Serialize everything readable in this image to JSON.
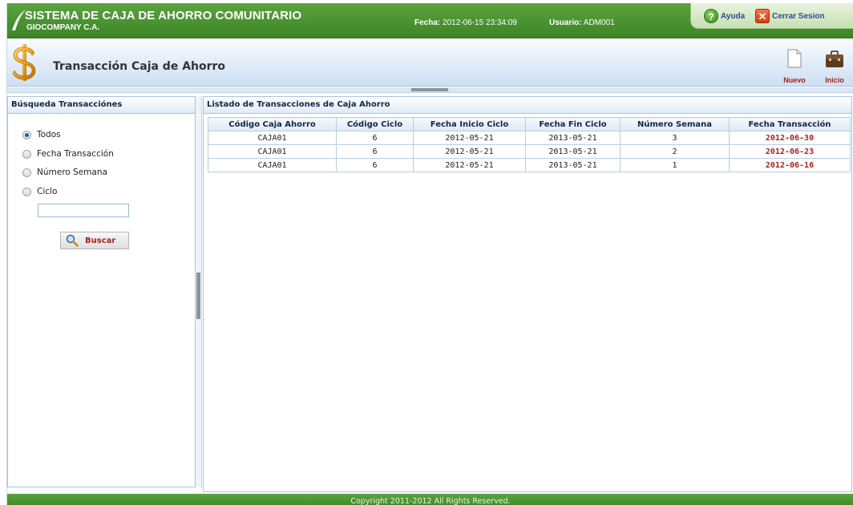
{
  "header": {
    "app_title": "SISTEMA DE CAJA DE AHORRO COMUNITARIO",
    "company": "GIOCOMPANY C.A.",
    "fecha_label": "Fecha:",
    "fecha_value": "2012-06-15 23:34:09",
    "usuario_label": "Usuario:",
    "usuario_value": "ADM001",
    "ayuda_label": "Ayuda",
    "cerrar_label": "Cerrar Sesion"
  },
  "titlebar": {
    "page_title": "Transacción Caja de Ahorro",
    "nuevo_label": "Nuevo",
    "inicio_label": "Inicio"
  },
  "search_panel": {
    "title": "Búsqueda Transacciónes",
    "options": [
      {
        "label": "Todos",
        "checked": true
      },
      {
        "label": "Fecha Transacción",
        "checked": false
      },
      {
        "label": "Número Semana",
        "checked": false
      },
      {
        "label": "Ciclo",
        "checked": false
      }
    ],
    "ciclo_value": "",
    "buscar_label": "Buscar"
  },
  "list_panel": {
    "title": "Listado de Transacciones de Caja Ahorro",
    "columns": [
      "Código Caja Ahorro",
      "Código Ciclo",
      "Fecha Inicio Ciclo",
      "Fecha Fin Ciclo",
      "Número Semana",
      "Fecha Transacción"
    ],
    "rows": [
      [
        "CAJA01",
        "6",
        "2012-05-21",
        "2013-05-21",
        "3",
        "2012-06-30"
      ],
      [
        "CAJA01",
        "6",
        "2012-05-21",
        "2013-05-21",
        "2",
        "2012-06-23"
      ],
      [
        "CAJA01",
        "6",
        "2012-05-21",
        "2013-05-21",
        "1",
        "2012-06-16"
      ]
    ]
  },
  "footer": {
    "copyright": "Copyright 2011-2012 All Rights Reserved."
  },
  "colors": {
    "header_green": "#3d8426",
    "accent_red": "#b01d1d",
    "panel_border": "#a9c3e2"
  }
}
